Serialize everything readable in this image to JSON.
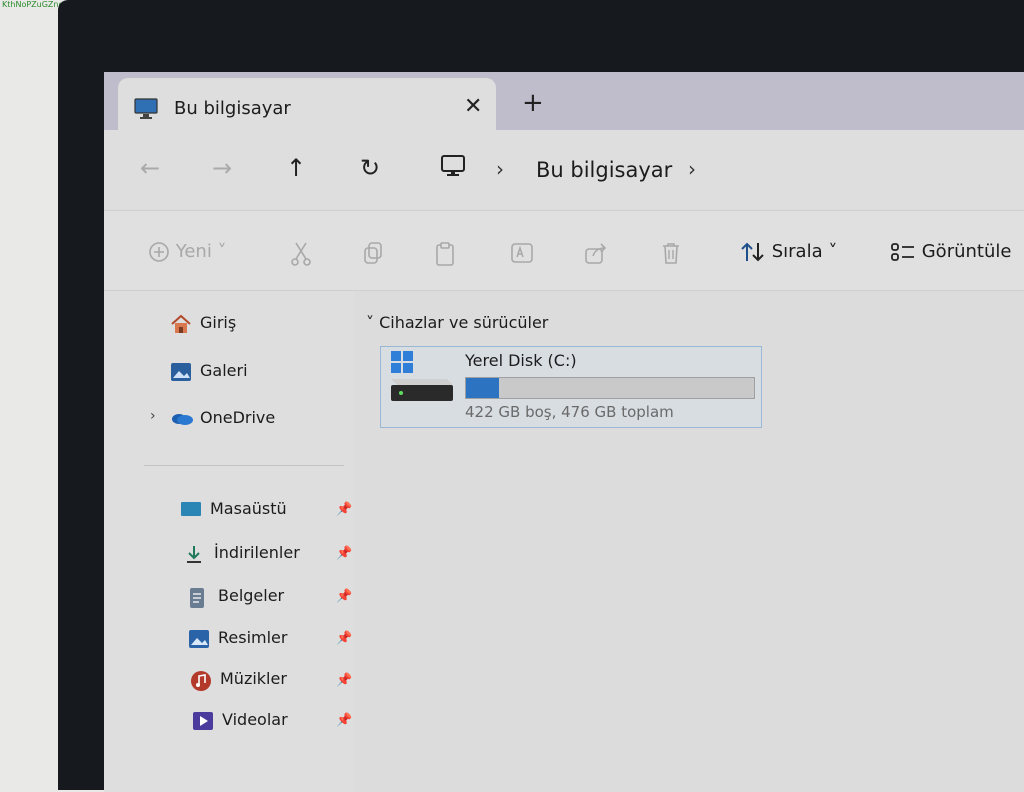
{
  "watermark": "KthNoPZuGZne",
  "tab": {
    "title": "Bu bilgisayar",
    "close": "✕",
    "new": "+"
  },
  "nav": {
    "back": "←",
    "forward": "→",
    "up": "↑",
    "refresh": "↻",
    "sep": "›",
    "breadcrumb": "Bu bilgisayar"
  },
  "toolbar": {
    "new_label": "Yeni",
    "sort_label": "Sırala",
    "view_label": "Görüntüle"
  },
  "sidebar": {
    "home": "Giriş",
    "gallery": "Galeri",
    "onedrive": "OneDrive",
    "quick": [
      {
        "label": "Masaüstü",
        "icon": "desktop-folder-icon"
      },
      {
        "label": "İndirilenler",
        "icon": "download-icon"
      },
      {
        "label": "Belgeler",
        "icon": "documents-icon"
      },
      {
        "label": "Resimler",
        "icon": "pictures-icon"
      },
      {
        "label": "Müzikler",
        "icon": "music-icon"
      },
      {
        "label": "Videolar",
        "icon": "videos-icon"
      }
    ]
  },
  "main": {
    "group_title": "Cihazlar ve sürücüler",
    "drive": {
      "name": "Yerel Disk (C:)",
      "free_text": "422 GB boş, 476 GB toplam",
      "used_fraction": 0.113
    }
  },
  "colors": {
    "accent": "#2c74c2",
    "tabbar": "#bfbccb"
  }
}
